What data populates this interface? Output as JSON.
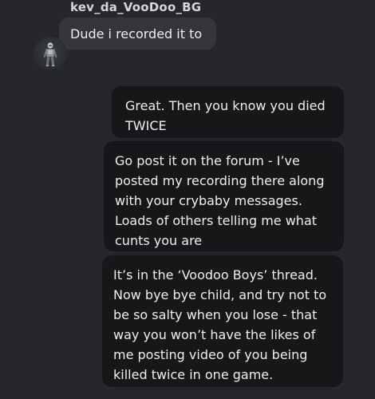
{
  "incoming": {
    "sender": "kev_da_VooDoo_BG",
    "avatar_icon": "armored-soldier-avatar",
    "message": "Dude i recorded it to"
  },
  "outgoing": [
    {
      "lines": [
        "Great. Then you know you died",
        "TWICE"
      ]
    },
    {
      "lines": [
        "Go post it on the forum - I’ve",
        "posted my recording there along",
        "with your crybaby messages.",
        "Loads of others telling me what",
        "cunts you are"
      ]
    },
    {
      "lines": [
        "It’s in the ‘Voodoo Boys’ thread.",
        "Now bye bye child, and try not to",
        "be so salty when you lose - that",
        "way you won’t have the likes of",
        "me posting video of you being",
        "killed twice in one game."
      ]
    }
  ],
  "colors": {
    "background": "#25272a",
    "incoming_bubble": "#34363a",
    "outgoing_bubble": "#161719",
    "text": "#eeeeee"
  }
}
